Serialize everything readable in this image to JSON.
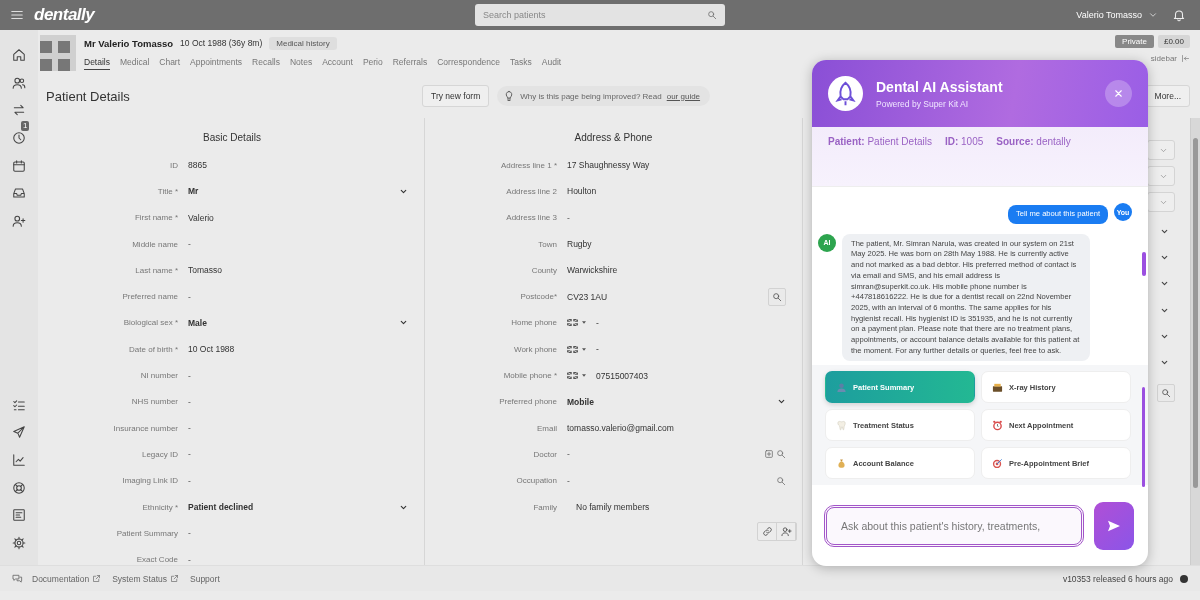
{
  "top_bar": {
    "logo": "dentally",
    "search": {
      "placeholder": "Search patients"
    },
    "user": "Valerio Tomasso"
  },
  "sidebar": {
    "badge": "1"
  },
  "patient": {
    "name": "Mr Valerio Tomasso",
    "dob": "10 Oct 1988 (36y 8m)",
    "badge": "Medical history",
    "status": "Private",
    "balance": "£0.00",
    "sidebar_link": "sidebar"
  },
  "tabs": [
    {
      "label": "Details",
      "selected": true
    },
    {
      "label": "Medical",
      "selected": false
    },
    {
      "label": "Chart",
      "selected": false
    },
    {
      "label": "Appointments",
      "selected": false
    },
    {
      "label": "Recalls",
      "selected": false
    },
    {
      "label": "Notes",
      "selected": false
    },
    {
      "label": "Account",
      "selected": false
    },
    {
      "label": "Perio",
      "selected": false
    },
    {
      "label": "Referrals",
      "selected": false
    },
    {
      "label": "Correspondence",
      "selected": false
    },
    {
      "label": "Tasks",
      "selected": false
    },
    {
      "label": "Audit",
      "selected": false
    }
  ],
  "page": {
    "title": "Patient Details",
    "button": "Try new form",
    "hint": "Why is this page being improved? Read",
    "hint_link": "our guide",
    "more_button": "More..."
  },
  "columns": [
    {
      "title": "Basic Details",
      "fields": [
        {
          "label": "ID",
          "value": "8865",
          "kind": "text"
        },
        {
          "label": "Title *",
          "value": "Mr",
          "kind": "select"
        },
        {
          "label": "First name *",
          "value": "Valerio",
          "kind": "text"
        },
        {
          "label": "Middle name",
          "value": "-",
          "kind": "text"
        },
        {
          "label": "Last name *",
          "value": "Tomasso",
          "kind": "text"
        },
        {
          "label": "Preferred name",
          "value": "-",
          "kind": "text"
        },
        {
          "label": "Biological sex *",
          "value": "Male",
          "kind": "select"
        },
        {
          "label": "Date of birth *",
          "value": "10 Oct 1988",
          "kind": "text"
        },
        {
          "label": "NI number",
          "value": "-",
          "kind": "text"
        },
        {
          "label": "NHS number",
          "value": "-",
          "kind": "text"
        },
        {
          "label": "Insurance number",
          "value": "-",
          "kind": "text"
        },
        {
          "label": "Legacy ID",
          "value": "-",
          "kind": "text"
        },
        {
          "label": "Imaging Link ID",
          "value": "-",
          "kind": "text"
        },
        {
          "label": "Ethnicity *",
          "value": "Patient declined",
          "kind": "select"
        },
        {
          "label": "Patient Summary",
          "value": "-",
          "kind": "text"
        },
        {
          "label": "Exact Code",
          "value": "-",
          "kind": "text"
        }
      ]
    },
    {
      "title": "Address & Phone",
      "family_actions": true,
      "fields": [
        {
          "label": "Address line 1 *",
          "value": "17 Shaughnessy Way",
          "kind": "text"
        },
        {
          "label": "Address line 2",
          "value": "Houlton",
          "kind": "text"
        },
        {
          "label": "Address line 3",
          "value": "-",
          "kind": "text"
        },
        {
          "label": "Town",
          "value": "Rugby",
          "kind": "text"
        },
        {
          "label": "County",
          "value": "Warwickshire",
          "kind": "text"
        },
        {
          "label": "Postcode*",
          "value": "CV23 1AU",
          "kind": "postcode"
        },
        {
          "label": "Home phone",
          "value": "-",
          "kind": "phone"
        },
        {
          "label": "Work phone",
          "value": "-",
          "kind": "phone"
        },
        {
          "label": "Mobile phone *",
          "value": "07515007403",
          "kind": "phone"
        },
        {
          "label": "Preferred phone",
          "value": "Mobile",
          "kind": "select"
        },
        {
          "label": "Email",
          "value": "tomasso.valerio@gmail.com",
          "kind": "text"
        },
        {
          "label": "Doctor",
          "value": "-",
          "kind": "add_lookup"
        },
        {
          "label": "Occupation",
          "value": "-",
          "kind": "lookup"
        },
        {
          "label": "Family",
          "value": "No family members",
          "kind": "family"
        }
      ]
    }
  ],
  "assistant": {
    "title": "Dental AI Assistant",
    "subtitle": "Powered by Super Kit AI",
    "context": [
      "**Patient:** Patient Details",
      "**ID:** 1005",
      "**Source:** dentally"
    ],
    "messages": [
      {
        "kind": "user",
        "avatar": "You",
        "text": "Tell me about this patient"
      },
      {
        "kind": "assistant",
        "avatar": "AI",
        "text": "The patient, Mr. Simran Narula, was created in our system on 21st May 2025. He was born on 28th May 1988. He is currently active and not marked as a bad debtor. His preferred method of contact is via email and SMS, and his email address is simran@superkit.co.uk. His mobile phone number is +447818616222. He is due for a dentist recall on 22nd November 2025, with an interval of 6 months. The same applies for his hygienist recall. His hygienist ID is 351935, and he is not currently on a payment plan. Please note that there are no treatment plans, appointments, or account balance details available for this patient at the moment. For any further details or queries, feel free to ask."
      }
    ],
    "quick_actions": [
      {
        "label": "Patient Summary",
        "selected": true
      },
      {
        "label": "X-ray History",
        "selected": false
      },
      {
        "label": "Treatment Status",
        "selected": false
      },
      {
        "label": "Next Appointment",
        "selected": false
      },
      {
        "label": "Account Balance",
        "selected": false
      },
      {
        "label": "Pre-Appointment Brief",
        "selected": false
      }
    ],
    "input": {
      "placeholder": "Ask about this patient's history, treatments,"
    }
  },
  "footer": {
    "links": [
      {
        "label": "Documentation",
        "external": true
      },
      {
        "label": "System Status",
        "external": true
      },
      {
        "label": "Support"
      }
    ],
    "version": "v10353 released 6 hours ago"
  }
}
